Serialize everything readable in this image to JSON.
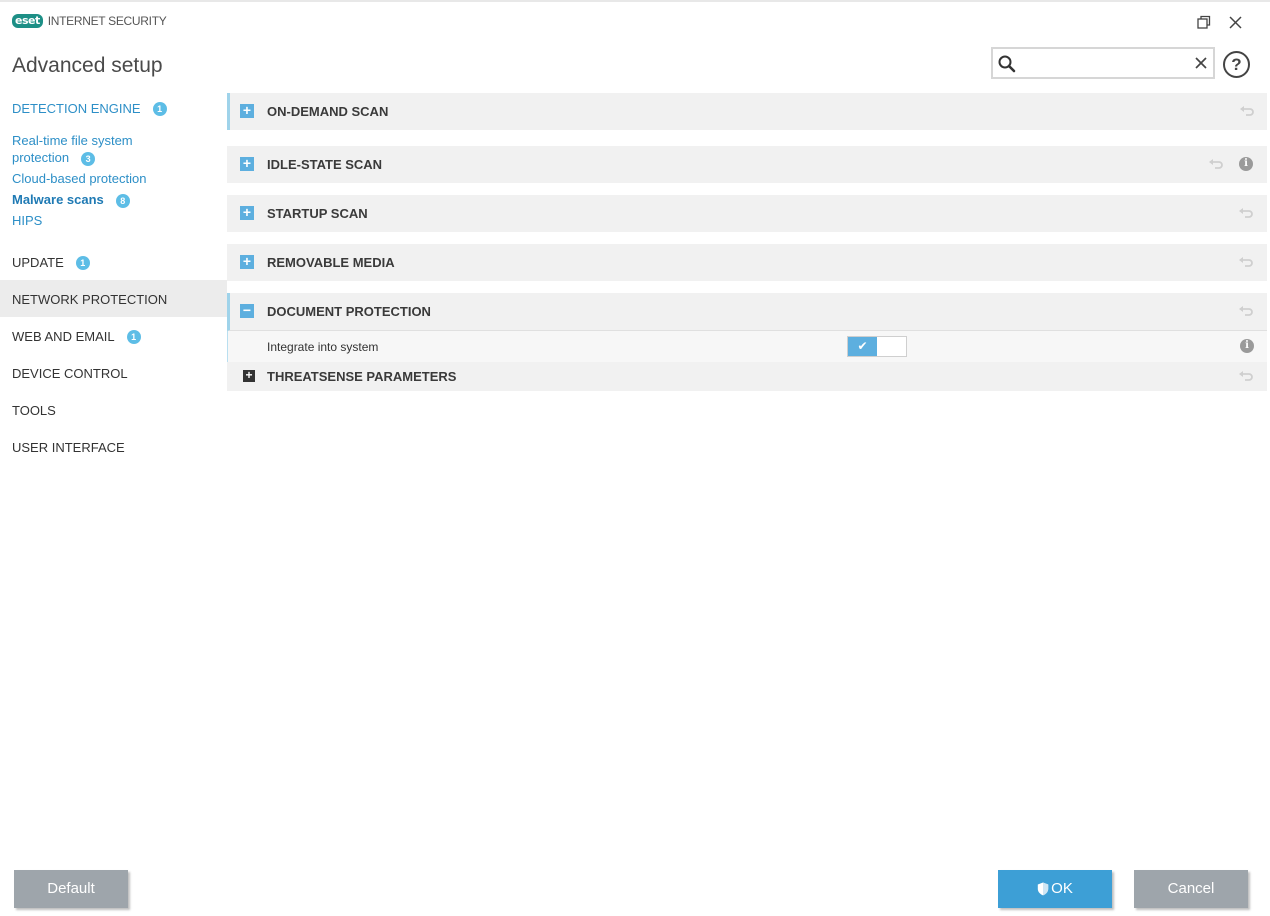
{
  "app": {
    "logo_text": "eset",
    "product_name": "INTERNET SECURITY",
    "page_title": "Advanced setup"
  },
  "search": {
    "value": "",
    "placeholder": ""
  },
  "help": {
    "label": "?"
  },
  "sidebar": {
    "items": [
      {
        "label": "DETECTION ENGINE",
        "badge": "1"
      },
      {
        "label": "Real-time file system",
        "label2": "protection",
        "badge": "3"
      },
      {
        "label": "Cloud-based protection"
      },
      {
        "label": "Malware scans",
        "badge": "8"
      },
      {
        "label": "HIPS"
      },
      {
        "label": "UPDATE",
        "badge": "1"
      },
      {
        "label": "NETWORK PROTECTION"
      },
      {
        "label": "WEB AND EMAIL",
        "badge": "1"
      },
      {
        "label": "DEVICE CONTROL"
      },
      {
        "label": "TOOLS"
      },
      {
        "label": "USER INTERFACE"
      }
    ]
  },
  "sections": [
    {
      "title": "ON-DEMAND SCAN",
      "toggle": "+"
    },
    {
      "title": "IDLE-STATE SCAN",
      "toggle": "+"
    },
    {
      "title": "STARTUP SCAN",
      "toggle": "+"
    },
    {
      "title": "REMOVABLE MEDIA",
      "toggle": "+"
    },
    {
      "title": "DOCUMENT PROTECTION",
      "toggle": "−"
    }
  ],
  "document_protection": {
    "setting_label": "Integrate into system",
    "setting_enabled": true,
    "check": "✔",
    "subsection_title": "THREATSENSE PARAMETERS",
    "subsection_toggle": "+"
  },
  "info_glyph": "i",
  "footer": {
    "default_label": "Default",
    "ok_label": "OK",
    "cancel_label": "Cancel"
  },
  "colors": {
    "accent": "#3d9fd6",
    "link": "#2d8fc7",
    "badge": "#5dbde6",
    "toggle": "#5dafdf",
    "button_gray": "#9ea5ab"
  }
}
